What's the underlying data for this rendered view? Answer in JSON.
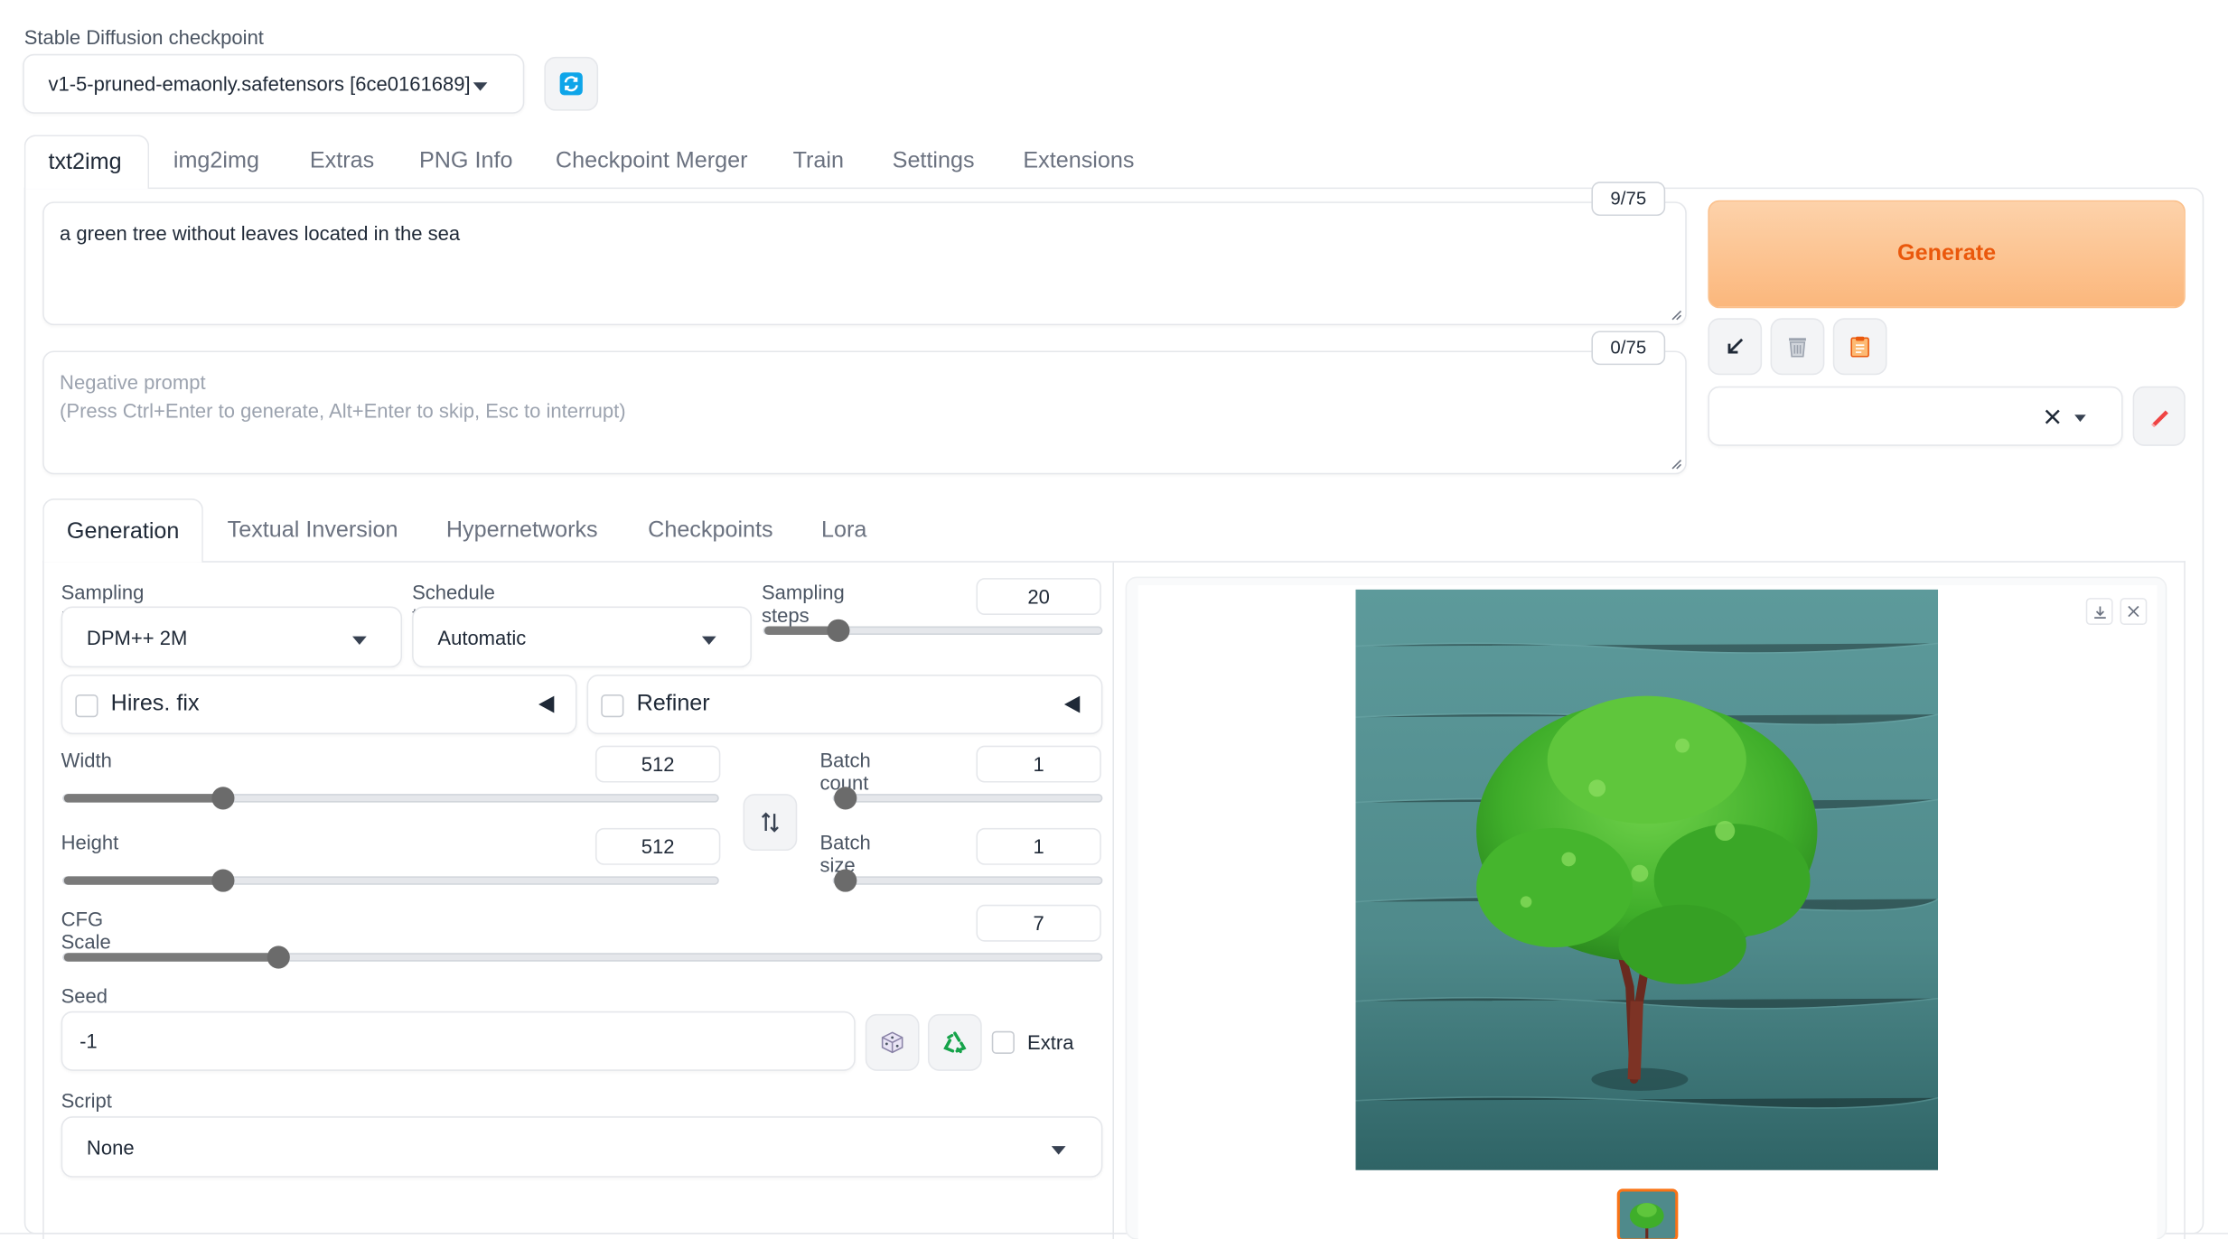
{
  "checkpoint": {
    "label": "Stable Diffusion checkpoint",
    "value": "v1-5-pruned-emaonly.safetensors [6ce0161689]"
  },
  "main_tabs": [
    "txt2img",
    "img2img",
    "Extras",
    "PNG Info",
    "Checkpoint Merger",
    "Train",
    "Settings",
    "Extensions"
  ],
  "prompt": {
    "value": "a green tree without leaves located in the sea",
    "token_count": "9/75"
  },
  "negative_prompt": {
    "placeholder_line1": "Negative prompt",
    "placeholder_line2": "(Press Ctrl+Enter to generate, Alt+Enter to skip, Esc to interrupt)",
    "token_count": "0/75"
  },
  "generate_label": "Generate",
  "sub_tabs": [
    "Generation",
    "Textual Inversion",
    "Hypernetworks",
    "Checkpoints",
    "Lora"
  ],
  "sampling_method": {
    "label": "Sampling method",
    "value": "DPM++ 2M"
  },
  "schedule_type": {
    "label": "Schedule type",
    "value": "Automatic"
  },
  "sampling_steps": {
    "label": "Sampling steps",
    "value": "20",
    "level": 0.2
  },
  "hires_fix": {
    "label": "Hires. fix"
  },
  "refiner": {
    "label": "Refiner"
  },
  "width": {
    "label": "Width",
    "value": "512",
    "level": 0.235
  },
  "height": {
    "label": "Height",
    "value": "512",
    "level": 0.235
  },
  "batch_count": {
    "label": "Batch count",
    "value": "1",
    "level": 0.0
  },
  "batch_size": {
    "label": "Batch size",
    "value": "1",
    "level": 0.0
  },
  "cfg_scale": {
    "label": "CFG Scale",
    "value": "7",
    "level": 0.2
  },
  "seed": {
    "label": "Seed",
    "value": "-1",
    "extra_label": "Extra"
  },
  "script": {
    "label": "Script",
    "value": "None"
  },
  "colors": {
    "accent": "#f97316",
    "generate_bg": "#fbb77c",
    "generate_text": "#ea580c",
    "sea": "#4f8a8b",
    "tree": "#3fae2a"
  },
  "icons": [
    "refresh-icon",
    "arrow-down-left-icon",
    "trash-icon",
    "clipboard-icon",
    "close-icon",
    "chevron-down-icon",
    "pencil-icon",
    "swap-icon",
    "dice-icon",
    "recycle-icon",
    "download-icon"
  ]
}
